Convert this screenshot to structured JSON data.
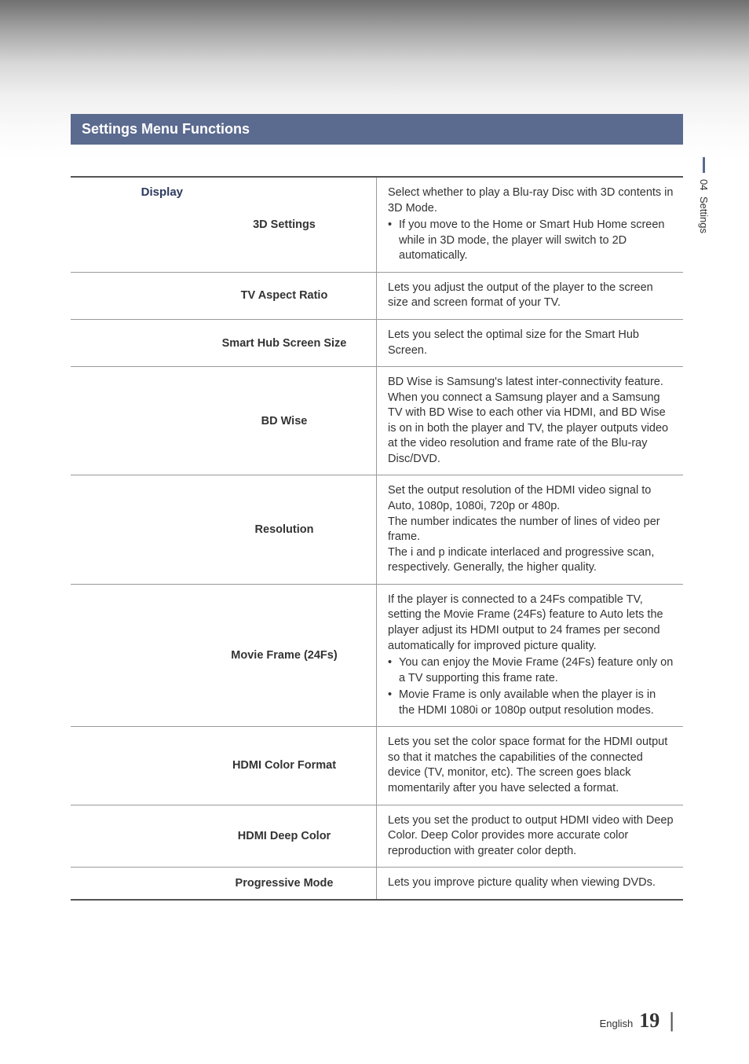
{
  "section_title": "Settings Menu Functions",
  "side_tab": {
    "chapter": "04",
    "label": "Settings"
  },
  "category": "Display",
  "rows": [
    {
      "setting": "3D Settings",
      "desc_pre": "Select whether to play a Blu-ray Disc with 3D contents in 3D Mode.",
      "bullets": [
        "If you move to the Home or Smart Hub Home screen while in 3D mode, the player will switch to 2D automatically."
      ]
    },
    {
      "setting": "TV Aspect Ratio",
      "desc_pre": "Lets you adjust the output of the player to the screen size and screen format of your TV."
    },
    {
      "setting": "Smart Hub Screen Size",
      "desc_pre": "Lets you select the optimal size for the Smart Hub Screen."
    },
    {
      "setting": "BD Wise",
      "desc_pre": "BD Wise is Samsung's latest inter-connectivity feature. When you connect a Samsung player and a Samsung TV with BD Wise to each other via HDMI, and BD Wise is on in both the player and TV, the player outputs video at the video resolution and frame rate of the Blu-ray Disc/DVD."
    },
    {
      "setting": "Resolution",
      "desc_pre": "Set the output resolution of the HDMI video signal to Auto, 1080p, 1080i, 720p or 480p.\nThe number indicates the number of lines of video per frame.\nThe i and p indicate interlaced and progressive scan, respectively. Generally, the higher quality."
    },
    {
      "setting": "Movie Frame (24Fs)",
      "desc_pre": "If the player is connected to a 24Fs compatible TV, setting the Movie Frame (24Fs) feature to Auto lets the player adjust its HDMI output to 24 frames per second automatically for improved picture quality.",
      "bullets": [
        "You can enjoy the Movie Frame (24Fs) feature only on a TV supporting this frame rate.",
        "Movie Frame is only available when the player is in the HDMI 1080i or 1080p output resolution modes."
      ]
    },
    {
      "setting": "HDMI Color Format",
      "desc_pre": "Lets you set the color space format for the HDMI output so that it matches the capabilities of the connected device (TV, monitor, etc). The screen goes black momentarily after you have selected a format."
    },
    {
      "setting": "HDMI Deep Color",
      "desc_pre": "Lets you set the product to output HDMI video with Deep Color. Deep Color provides more accurate color reproduction with greater color depth."
    },
    {
      "setting": "Progressive Mode",
      "desc_pre": "Lets you improve picture quality when viewing DVDs."
    }
  ],
  "footer": {
    "lang": "English",
    "page": "19"
  }
}
